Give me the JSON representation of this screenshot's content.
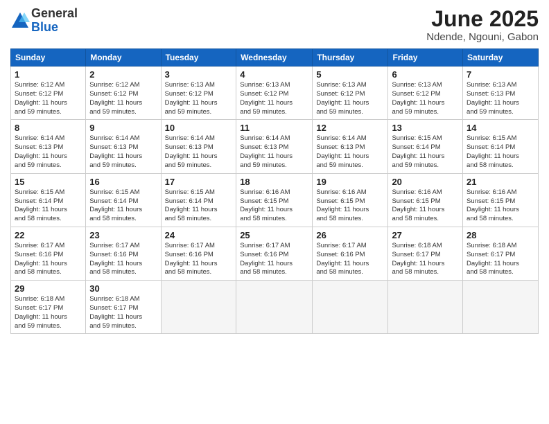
{
  "logo": {
    "general": "General",
    "blue": "Blue"
  },
  "title": "June 2025",
  "subtitle": "Ndende, Ngouni, Gabon",
  "headers": [
    "Sunday",
    "Monday",
    "Tuesday",
    "Wednesday",
    "Thursday",
    "Friday",
    "Saturday"
  ],
  "weeks": [
    [
      {
        "day": "1",
        "info": "Sunrise: 6:12 AM\nSunset: 6:12 PM\nDaylight: 11 hours\nand 59 minutes."
      },
      {
        "day": "2",
        "info": "Sunrise: 6:12 AM\nSunset: 6:12 PM\nDaylight: 11 hours\nand 59 minutes."
      },
      {
        "day": "3",
        "info": "Sunrise: 6:13 AM\nSunset: 6:12 PM\nDaylight: 11 hours\nand 59 minutes."
      },
      {
        "day": "4",
        "info": "Sunrise: 6:13 AM\nSunset: 6:12 PM\nDaylight: 11 hours\nand 59 minutes."
      },
      {
        "day": "5",
        "info": "Sunrise: 6:13 AM\nSunset: 6:12 PM\nDaylight: 11 hours\nand 59 minutes."
      },
      {
        "day": "6",
        "info": "Sunrise: 6:13 AM\nSunset: 6:12 PM\nDaylight: 11 hours\nand 59 minutes."
      },
      {
        "day": "7",
        "info": "Sunrise: 6:13 AM\nSunset: 6:13 PM\nDaylight: 11 hours\nand 59 minutes."
      }
    ],
    [
      {
        "day": "8",
        "info": "Sunrise: 6:14 AM\nSunset: 6:13 PM\nDaylight: 11 hours\nand 59 minutes."
      },
      {
        "day": "9",
        "info": "Sunrise: 6:14 AM\nSunset: 6:13 PM\nDaylight: 11 hours\nand 59 minutes."
      },
      {
        "day": "10",
        "info": "Sunrise: 6:14 AM\nSunset: 6:13 PM\nDaylight: 11 hours\nand 59 minutes."
      },
      {
        "day": "11",
        "info": "Sunrise: 6:14 AM\nSunset: 6:13 PM\nDaylight: 11 hours\nand 59 minutes."
      },
      {
        "day": "12",
        "info": "Sunrise: 6:14 AM\nSunset: 6:13 PM\nDaylight: 11 hours\nand 59 minutes."
      },
      {
        "day": "13",
        "info": "Sunrise: 6:15 AM\nSunset: 6:14 PM\nDaylight: 11 hours\nand 59 minutes."
      },
      {
        "day": "14",
        "info": "Sunrise: 6:15 AM\nSunset: 6:14 PM\nDaylight: 11 hours\nand 58 minutes."
      }
    ],
    [
      {
        "day": "15",
        "info": "Sunrise: 6:15 AM\nSunset: 6:14 PM\nDaylight: 11 hours\nand 58 minutes."
      },
      {
        "day": "16",
        "info": "Sunrise: 6:15 AM\nSunset: 6:14 PM\nDaylight: 11 hours\nand 58 minutes."
      },
      {
        "day": "17",
        "info": "Sunrise: 6:15 AM\nSunset: 6:14 PM\nDaylight: 11 hours\nand 58 minutes."
      },
      {
        "day": "18",
        "info": "Sunrise: 6:16 AM\nSunset: 6:15 PM\nDaylight: 11 hours\nand 58 minutes."
      },
      {
        "day": "19",
        "info": "Sunrise: 6:16 AM\nSunset: 6:15 PM\nDaylight: 11 hours\nand 58 minutes."
      },
      {
        "day": "20",
        "info": "Sunrise: 6:16 AM\nSunset: 6:15 PM\nDaylight: 11 hours\nand 58 minutes."
      },
      {
        "day": "21",
        "info": "Sunrise: 6:16 AM\nSunset: 6:15 PM\nDaylight: 11 hours\nand 58 minutes."
      }
    ],
    [
      {
        "day": "22",
        "info": "Sunrise: 6:17 AM\nSunset: 6:16 PM\nDaylight: 11 hours\nand 58 minutes."
      },
      {
        "day": "23",
        "info": "Sunrise: 6:17 AM\nSunset: 6:16 PM\nDaylight: 11 hours\nand 58 minutes."
      },
      {
        "day": "24",
        "info": "Sunrise: 6:17 AM\nSunset: 6:16 PM\nDaylight: 11 hours\nand 58 minutes."
      },
      {
        "day": "25",
        "info": "Sunrise: 6:17 AM\nSunset: 6:16 PM\nDaylight: 11 hours\nand 58 minutes."
      },
      {
        "day": "26",
        "info": "Sunrise: 6:17 AM\nSunset: 6:16 PM\nDaylight: 11 hours\nand 58 minutes."
      },
      {
        "day": "27",
        "info": "Sunrise: 6:18 AM\nSunset: 6:17 PM\nDaylight: 11 hours\nand 58 minutes."
      },
      {
        "day": "28",
        "info": "Sunrise: 6:18 AM\nSunset: 6:17 PM\nDaylight: 11 hours\nand 58 minutes."
      }
    ],
    [
      {
        "day": "29",
        "info": "Sunrise: 6:18 AM\nSunset: 6:17 PM\nDaylight: 11 hours\nand 59 minutes."
      },
      {
        "day": "30",
        "info": "Sunrise: 6:18 AM\nSunset: 6:17 PM\nDaylight: 11 hours\nand 59 minutes."
      },
      {
        "day": "",
        "info": ""
      },
      {
        "day": "",
        "info": ""
      },
      {
        "day": "",
        "info": ""
      },
      {
        "day": "",
        "info": ""
      },
      {
        "day": "",
        "info": ""
      }
    ]
  ]
}
